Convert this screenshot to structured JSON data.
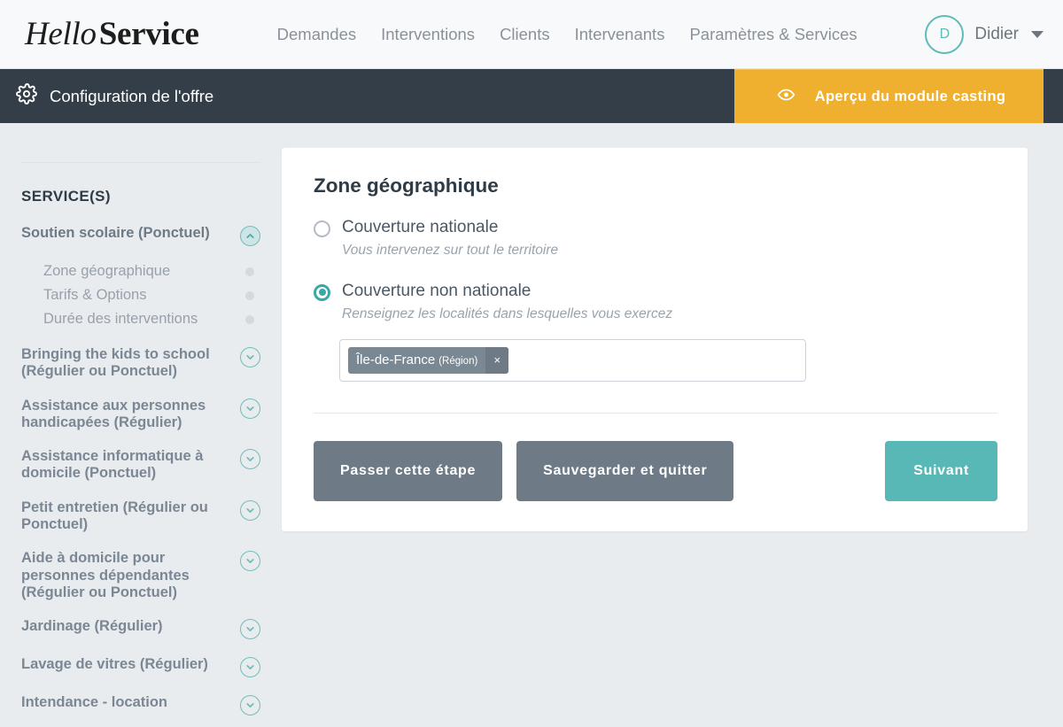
{
  "header": {
    "brand": {
      "first": "Hello",
      "second": "Service"
    },
    "nav": [
      {
        "label": "Demandes",
        "name": "nav-demandes"
      },
      {
        "label": "Interventions",
        "name": "nav-interventions"
      },
      {
        "label": "Clients",
        "name": "nav-clients"
      },
      {
        "label": "Intervenants",
        "name": "nav-intervenants"
      },
      {
        "label": "Paramètres & Services",
        "name": "nav-parametres-services"
      }
    ],
    "user": {
      "initial": "D",
      "name": "Didier",
      "caret_icon": "chevron-down-icon"
    }
  },
  "configbar": {
    "gear_icon": "gear-icon",
    "title": "Configuration de l'offre",
    "preview": {
      "eye_icon": "eye-icon",
      "label": "Aperçu du module casting",
      "background": "#eeb02e"
    },
    "background": "#343e48"
  },
  "sidebar": {
    "heading": "SERVICE(S)",
    "services": [
      {
        "label": "Soutien scolaire (Ponctuel)",
        "expanded": true,
        "icon": "chevron-up-icon",
        "subitems": [
          {
            "label": "Zone géographique",
            "status_icon": "status-dot-icon"
          },
          {
            "label": "Tarifs & Options",
            "status_icon": "status-dot-icon"
          },
          {
            "label": "Durée des interventions",
            "status_icon": "status-dot-icon"
          }
        ]
      },
      {
        "label": "Bringing the kids to school (Régulier ou Ponctuel)",
        "expanded": false,
        "icon": "chevron-down-icon"
      },
      {
        "label": "Assistance aux personnes handicapées (Régulier)",
        "expanded": false,
        "icon": "chevron-down-icon"
      },
      {
        "label": "Assistance informatique à domicile (Ponctuel)",
        "expanded": false,
        "icon": "chevron-down-icon"
      },
      {
        "label": "Petit entretien (Régulier ou Ponctuel)",
        "expanded": false,
        "icon": "chevron-down-icon"
      },
      {
        "label": "Aide à domicile pour personnes dépendantes (Régulier ou Ponctuel)",
        "expanded": false,
        "icon": "chevron-down-icon"
      },
      {
        "label": "Jardinage (Régulier)",
        "expanded": false,
        "icon": "chevron-down-icon"
      },
      {
        "label": "Lavage de vitres (Régulier)",
        "expanded": false,
        "icon": "chevron-down-icon"
      },
      {
        "label": "Intendance - location",
        "expanded": false,
        "icon": "chevron-down-icon"
      }
    ]
  },
  "main": {
    "card_title": "Zone géographique",
    "options": [
      {
        "label": "Couverture nationale",
        "hint": "Vous intervenez sur tout le territoire",
        "selected": false
      },
      {
        "label": "Couverture non nationale",
        "hint": "Renseignez les localités dans lesquelles vous exercez",
        "selected": true
      }
    ],
    "locality_input": {
      "placeholder": "",
      "value": "",
      "tags": [
        {
          "name": "Île-de-France",
          "kind": "(Région)",
          "remove_icon": "close-icon"
        }
      ]
    },
    "buttons": {
      "skip": "Passer cette étape",
      "save_quit": "Sauvegarder et quitter",
      "next": "Suivant"
    }
  },
  "colors": {
    "accent_teal": "#57b8b6",
    "amber": "#eeb02e",
    "dark_slate": "#343e48",
    "grey_button": "#6e7b87",
    "page_bg": "#e9ecef"
  }
}
